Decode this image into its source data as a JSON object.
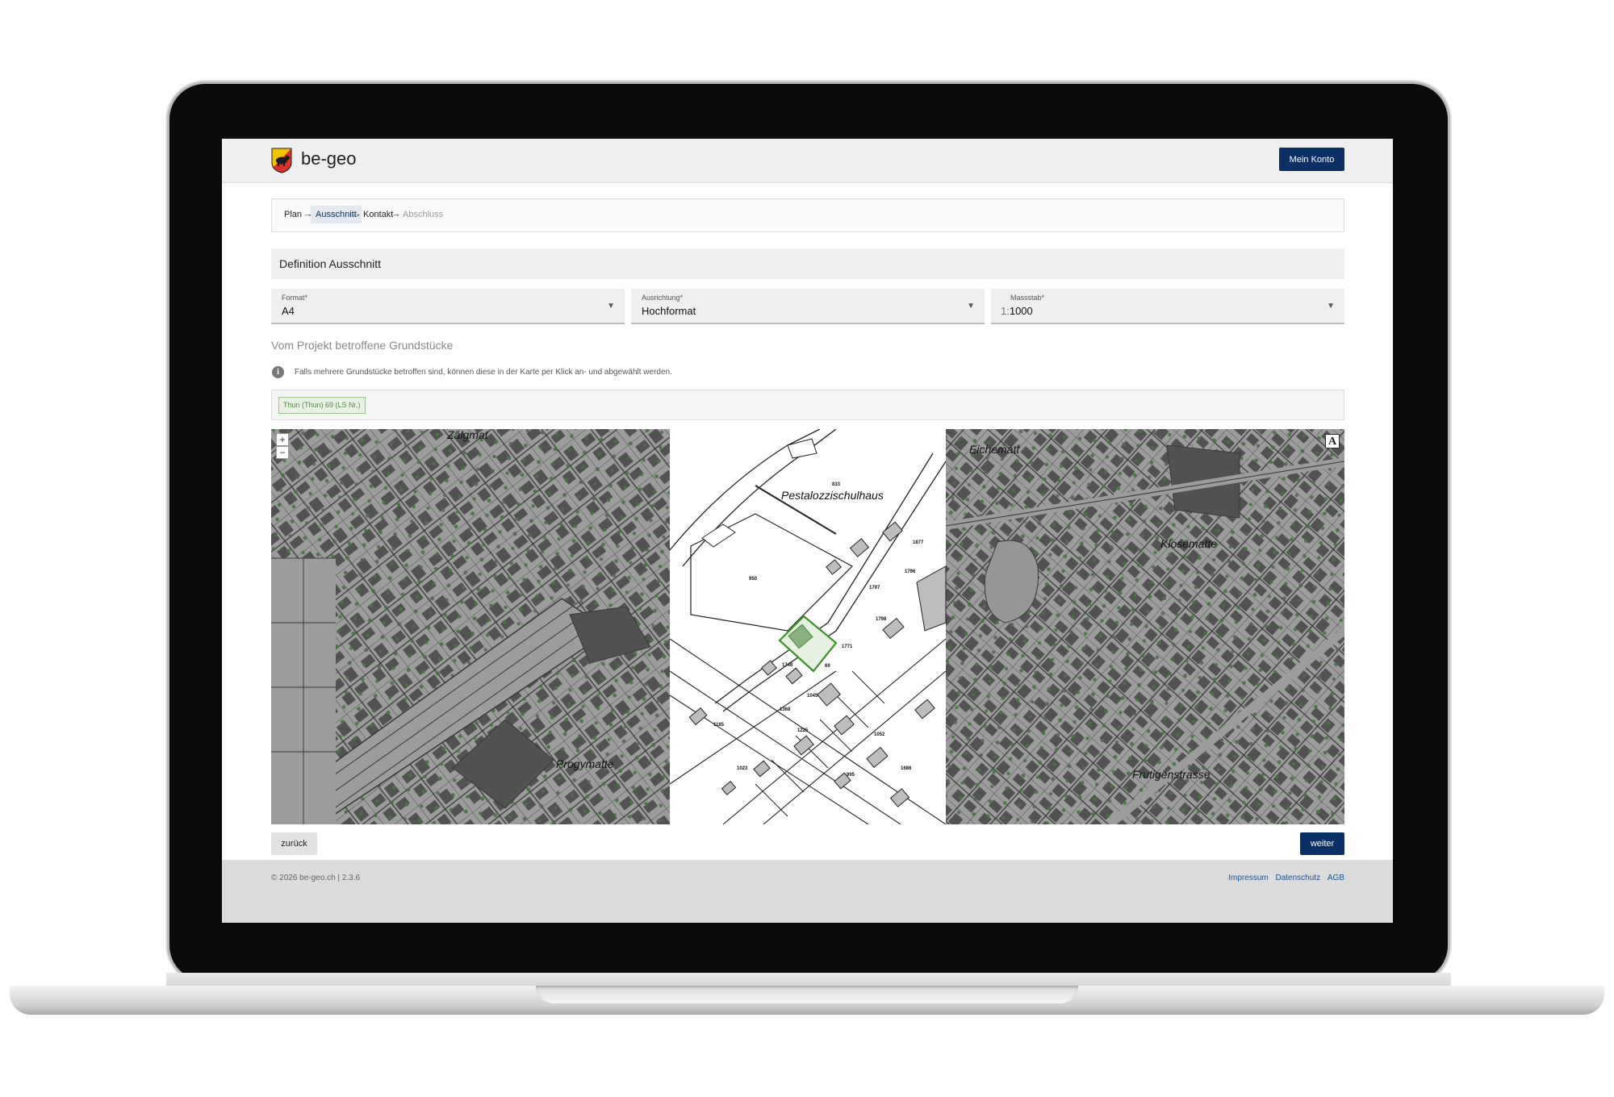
{
  "header": {
    "brand": "be-geo",
    "account_button": "Mein Konto"
  },
  "stepper": {
    "steps": [
      {
        "label": "Plan",
        "state": "done"
      },
      {
        "label": "Ausschnitt",
        "state": "active"
      },
      {
        "label": "Kontakt",
        "state": "done"
      },
      {
        "label": "Abschluss",
        "state": "disabled"
      }
    ]
  },
  "section": {
    "title": "Definition Ausschnitt"
  },
  "fields": {
    "format": {
      "label": "Format*",
      "value": "A4"
    },
    "orientation": {
      "label": "Ausrichtung*",
      "value": "Hochformat"
    },
    "scale": {
      "label": "Massstab*",
      "prefix": "1:",
      "value": "1000"
    }
  },
  "parcels": {
    "heading": "Vom Projekt betroffene Grundstücke",
    "info": "Falls mehrere Grundstücke betroffen sind, können diese in der Karte per Klick an- und abgewählt werden.",
    "selected": [
      "Thun (Thun) 69 (LS Nr.)"
    ]
  },
  "map": {
    "zoom_in": "+",
    "zoom_out": "−",
    "north": "A",
    "labels": {
      "pestalozzi": "Pestalozzischulhaus",
      "progymatte": "Progymatte",
      "klosematte": "Klosematte",
      "frutigenstrasse": "Frutigenstrasse",
      "zulgmatt": "Zälgmat",
      "eichematt": "Eichematt",
      "parcel": "69",
      "parcel_950": "950",
      "parcel_833": "833",
      "parcel_1771": "1771",
      "parcel_1748": "1748",
      "parcel_1052": "1052",
      "parcel_995": "995",
      "parcel_1023": "1023",
      "parcel_1185": "1185",
      "parcel_1225": "1225",
      "parcel_1045": "1045",
      "parcel_1368": "1368",
      "parcel_1798": "1798",
      "parcel_1797": "1797",
      "parcel_1796": "1796",
      "parcel_1877": "1877",
      "parcel_1686": "1686"
    },
    "colors": {
      "selection": "#3f8f2f",
      "mask": "#8d8d8d",
      "vertex": "#4f9a44"
    }
  },
  "actions": {
    "back": "zurück",
    "next": "weiter"
  },
  "footer": {
    "copyright": "© 2026 be-geo.ch | 2.3.6",
    "links": [
      "Impressum",
      "Datenschutz",
      "AGB"
    ]
  }
}
